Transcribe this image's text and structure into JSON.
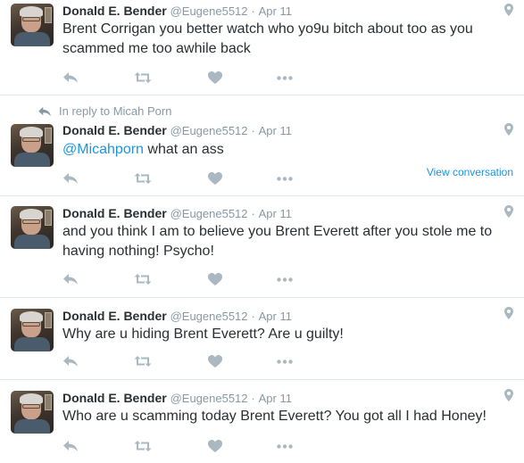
{
  "tweets": [
    {
      "name": "Donald E. Bender",
      "handle": "@Eugene5512",
      "sep": "·",
      "date": "Apr 11",
      "text_parts": [
        "Brent Corrigan you better watch who yo9u bitch about too as you scammed me too awhile back"
      ]
    },
    {
      "reply_to": "In reply to Micah Porn",
      "name": "Donald E. Bender",
      "handle": "@Eugene5512",
      "sep": "·",
      "date": "Apr 11",
      "mention": "@Micahporn",
      "text_after": " what an ass",
      "view_conversation": "View conversation"
    },
    {
      "name": "Donald E. Bender",
      "handle": "@Eugene5512",
      "sep": "·",
      "date": "Apr 11",
      "text_parts": [
        "and you think I am to believe you Brent Everett after you stole me to having nothing! Psycho!"
      ]
    },
    {
      "name": "Donald E. Bender",
      "handle": "@Eugene5512",
      "sep": "·",
      "date": "Apr 11",
      "text_parts": [
        "Why are u hiding Brent Everett? Are u guilty!"
      ]
    },
    {
      "name": "Donald E. Bender",
      "handle": "@Eugene5512",
      "sep": "·",
      "date": "Apr 11",
      "text_parts": [
        "Who are u scamming today Brent Everett? You got all I had Honey!"
      ]
    }
  ],
  "icons": {
    "reply": "reply-arrow",
    "retweet": "retweet-arrows",
    "like": "heart",
    "more": "ellipsis",
    "location": "map-pin",
    "icon_color": "#aab8c2",
    "accent": "#1b95e0"
  }
}
